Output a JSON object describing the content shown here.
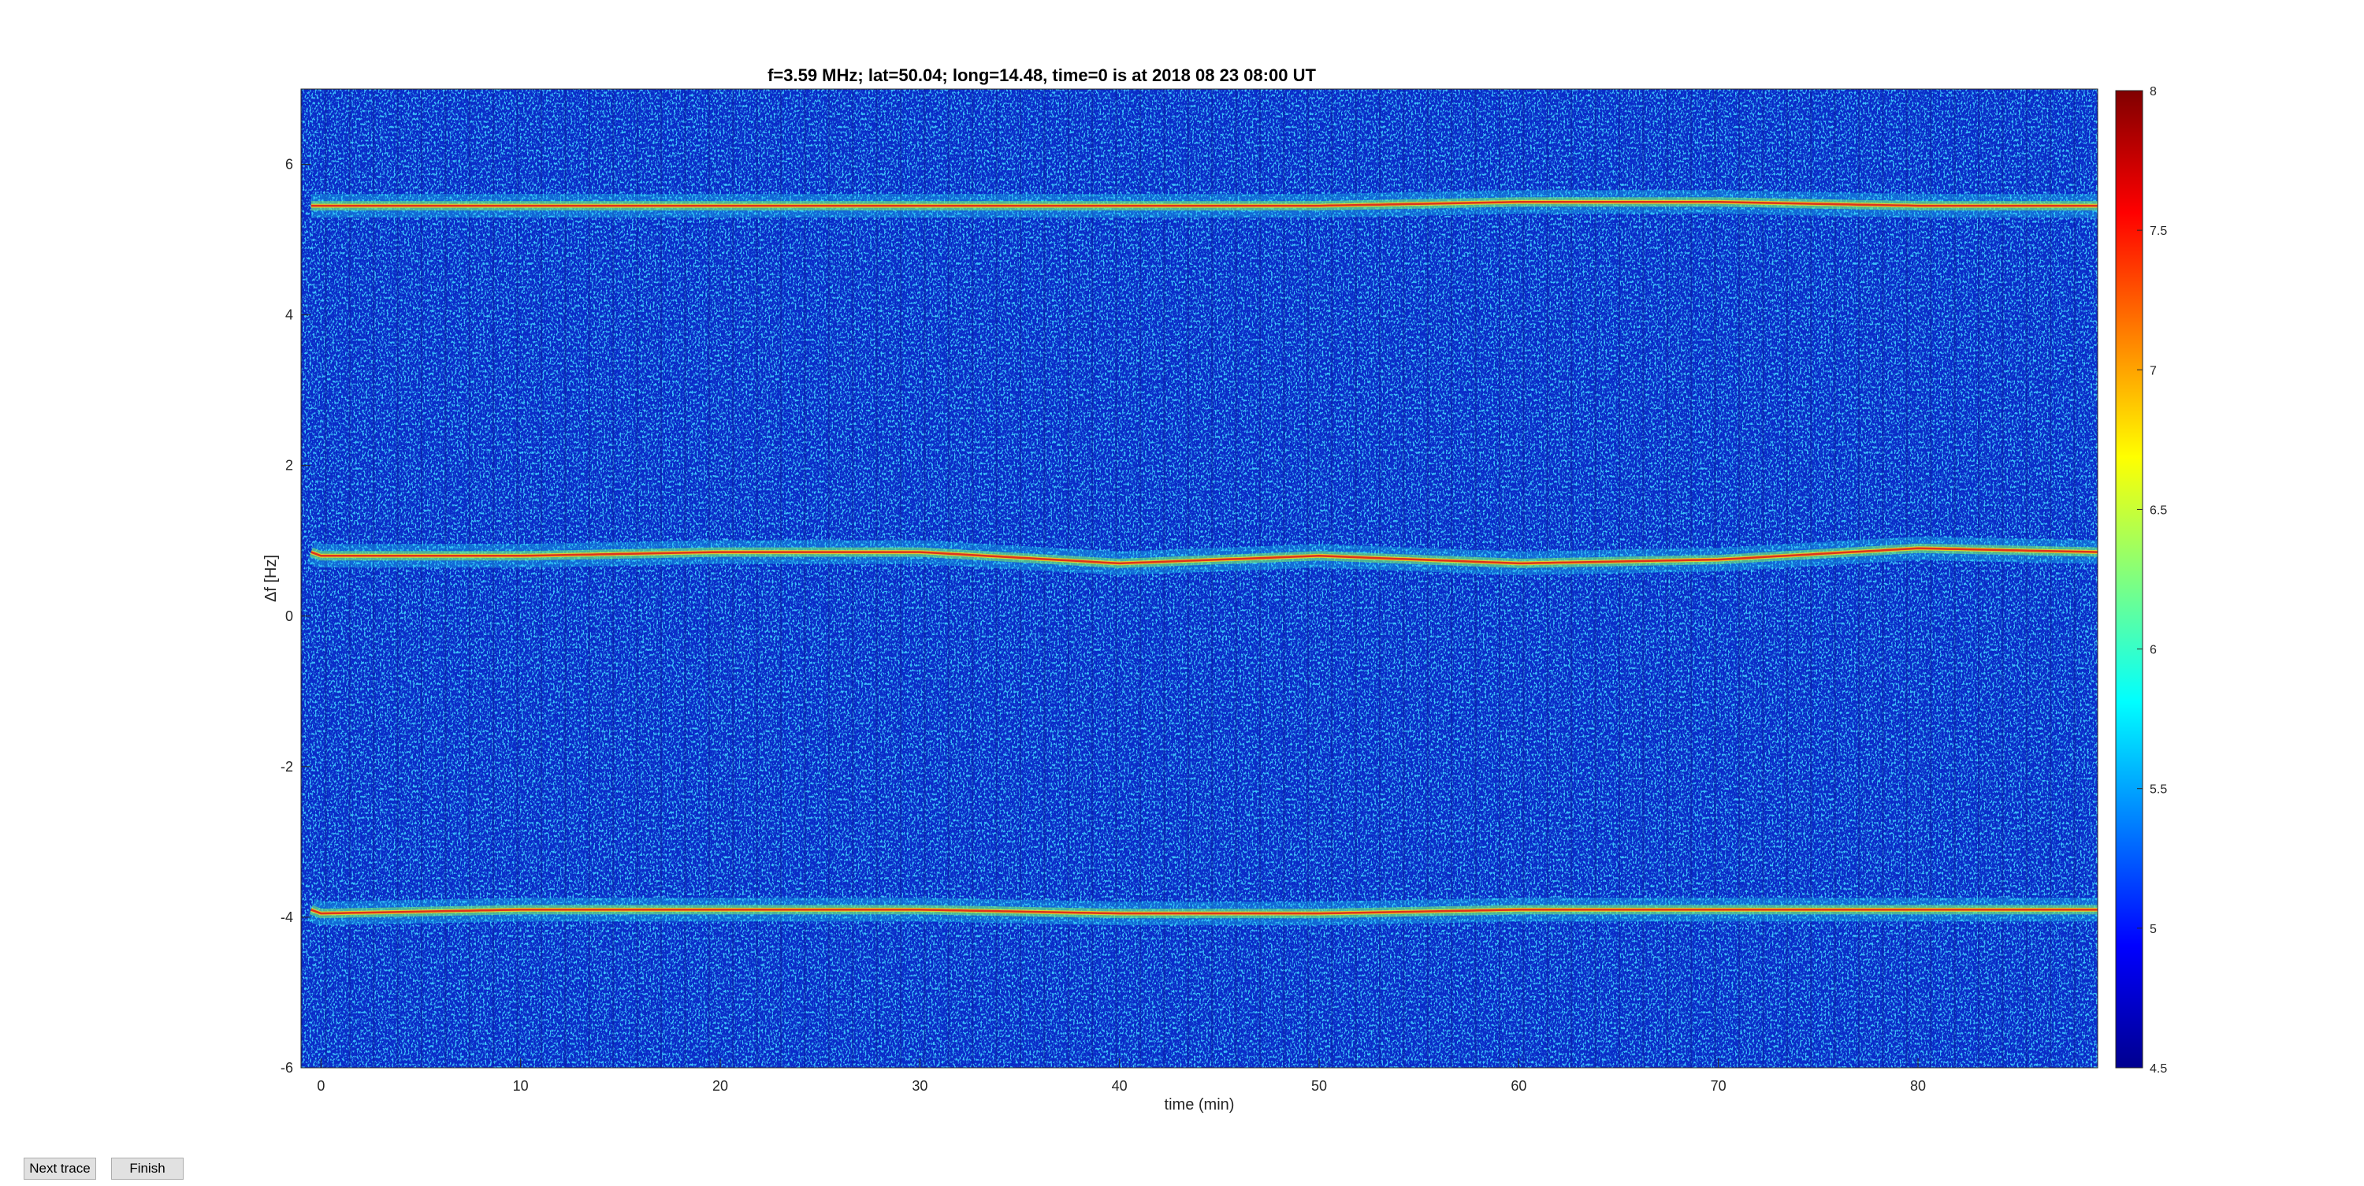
{
  "chart_data": {
    "type": "heatmap",
    "title": "f=3.59 MHz;  lat=50.04; long=14.48, time=0 is at 2018 08 23 08:00 UT",
    "xlabel": "time (min)",
    "ylabel": "Δf [Hz]",
    "xlim": [
      -1,
      89
    ],
    "ylim": [
      -6,
      7
    ],
    "x_ticks": [
      "0",
      "10",
      "20",
      "30",
      "40",
      "50",
      "60",
      "70",
      "80"
    ],
    "y_ticks": [
      "-6",
      "-4",
      "-2",
      "0",
      "2",
      "4",
      "6"
    ],
    "colorbar": {
      "colormap": "jet",
      "range": [
        4.5,
        8
      ],
      "ticks": [
        "4.5",
        "5",
        "5.5",
        "6",
        "6.5",
        "7",
        "7.5",
        "8"
      ]
    },
    "traces": [
      {
        "x": [
          0,
          10,
          20,
          30,
          40,
          50,
          60,
          70,
          80,
          89
        ],
        "y": [
          5.45,
          5.45,
          5.45,
          5.45,
          5.45,
          5.45,
          5.5,
          5.5,
          5.45,
          5.45
        ]
      },
      {
        "x": [
          0,
          10,
          20,
          30,
          40,
          50,
          60,
          70,
          80,
          89
        ],
        "y": [
          0.8,
          0.8,
          0.85,
          0.85,
          0.7,
          0.8,
          0.7,
          0.75,
          0.9,
          0.85
        ]
      },
      {
        "x": [
          0,
          10,
          20,
          30,
          40,
          50,
          60,
          70,
          80,
          89
        ],
        "y": [
          -3.95,
          -3.9,
          -3.9,
          -3.9,
          -3.95,
          -3.95,
          -3.9,
          -3.9,
          -3.9,
          -3.9
        ]
      }
    ]
  },
  "buttons": {
    "next_trace": "Next trace",
    "finish": "Finish"
  }
}
